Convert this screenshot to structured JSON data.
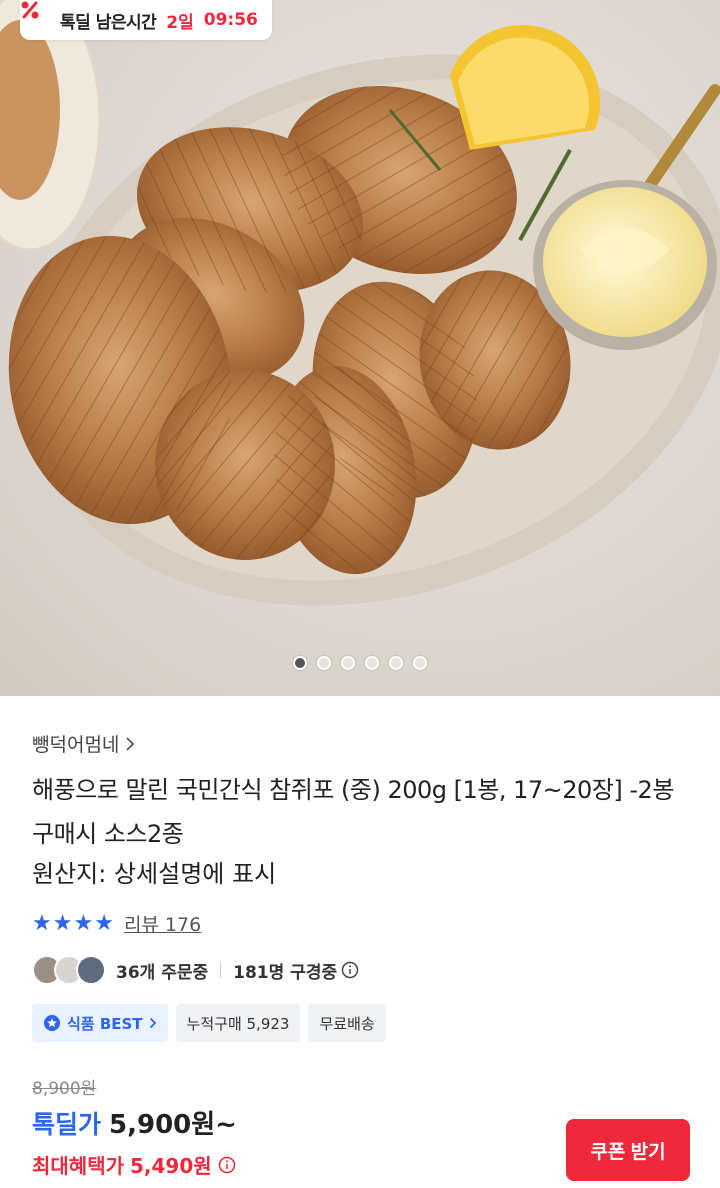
{
  "deal_banner": {
    "label": "톡딜 남은시간",
    "days": "2일",
    "time": "09:56"
  },
  "carousel": {
    "total": 6,
    "active": 0
  },
  "seller": {
    "name": "뺑덕어멈네"
  },
  "product": {
    "title": "해풍으로 말린 국민간식 참쥐포 (중) 200g [1봉, 17~20장] -2봉 구매시 소스2종",
    "origin": "원산지: 상세설명에 표시"
  },
  "rating": {
    "stars": 4,
    "review_label": "리뷰 176"
  },
  "social": {
    "ordering": "36개 주문중",
    "viewing": "181명 구경중"
  },
  "badges": {
    "best": "식품 BEST",
    "cumulative": "누적구매 5,923",
    "shipping": "무료배송"
  },
  "price": {
    "original": "8,900원",
    "deal_label": "톡딜가",
    "deal_amount": "5,900원~",
    "max_label": "최대혜택가",
    "max_amount": "5,490원"
  },
  "coupon_button": "쿠폰 받기",
  "colors": {
    "accent_red": "#f0283c",
    "accent_blue": "#2d64f0"
  }
}
